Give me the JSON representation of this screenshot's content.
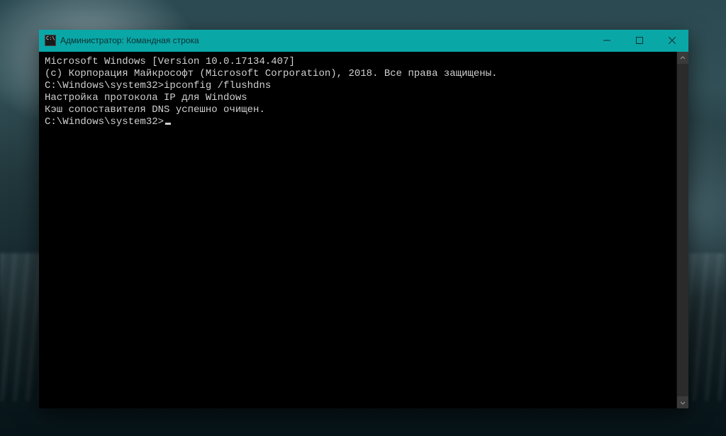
{
  "window": {
    "title": "Администратор: Командная строка",
    "colors": {
      "title_bg": "#0aa7a7",
      "title_fg": "#0d2f2f",
      "term_bg": "#000000",
      "term_fg": "#d0d0d0"
    }
  },
  "icons": {
    "app": "cmd-icon",
    "minimize": "minimize-icon",
    "maximize": "maximize-icon",
    "close": "close-icon",
    "scroll_up": "chevron-up-icon",
    "scroll_down": "chevron-down-icon"
  },
  "terminal": {
    "lines": [
      "Microsoft Windows [Version 10.0.17134.407]",
      "(c) Корпорация Майкрософт (Microsoft Corporation), 2018. Все права защищены.",
      "",
      "C:\\Windows\\system32>ipconfig /flushdns",
      "",
      "Настройка протокола IP для Windows",
      "",
      "Кэш сопоставителя DNS успешно очищен.",
      "",
      "C:\\Windows\\system32>"
    ],
    "show_cursor_on_last_line": true
  }
}
